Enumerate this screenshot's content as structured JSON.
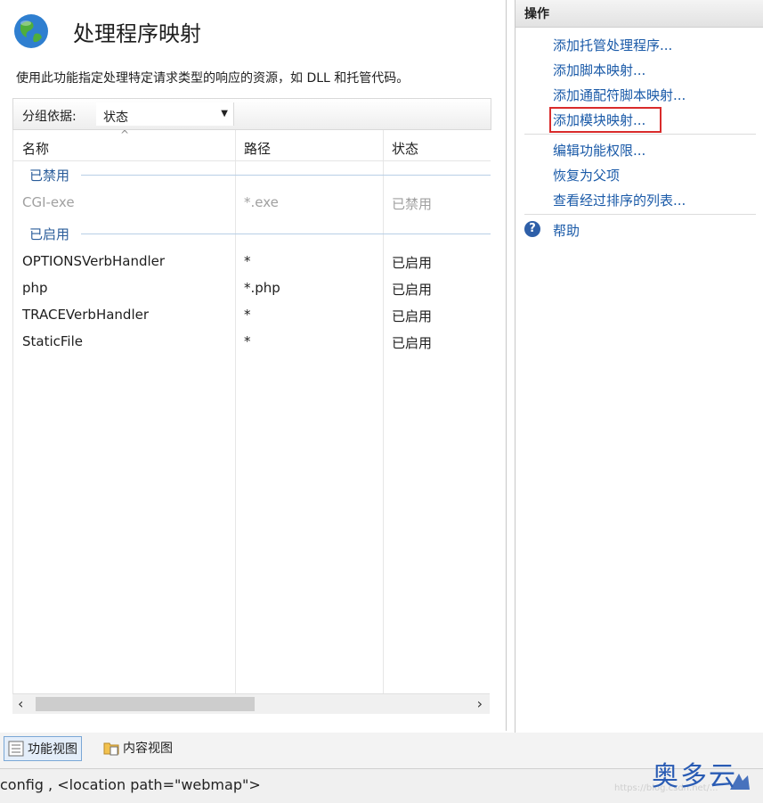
{
  "page": {
    "title": "处理程序映射",
    "description": "使用此功能指定处理特定请求类型的响应的资源，如 DLL 和托管代码。"
  },
  "groupby": {
    "label": "分组依据:",
    "value": "状态"
  },
  "columns": [
    "名称",
    "路径",
    "状态"
  ],
  "groups": [
    {
      "label": "已禁用",
      "rows": [
        {
          "name": "CGI-exe",
          "path": "*.exe",
          "status": "已禁用"
        }
      ]
    },
    {
      "label": "已启用",
      "rows": [
        {
          "name": "OPTIONSVerbHandler",
          "path": "*",
          "status": "已启用"
        },
        {
          "name": "php",
          "path": "*.php",
          "status": "已启用"
        },
        {
          "name": "TRACEVerbHandler",
          "path": "*",
          "status": "已启用"
        },
        {
          "name": "StaticFile",
          "path": "*",
          "status": "已启用"
        }
      ]
    }
  ],
  "actions": {
    "title": "操作",
    "items": [
      "添加托管处理程序...",
      "添加脚本映射...",
      "添加通配符脚本映射...",
      "添加模块映射...",
      "编辑功能权限...",
      "恢复为父项",
      "查看经过排序的列表...",
      "帮助"
    ]
  },
  "view_tabs": [
    "功能视图",
    "内容视图"
  ],
  "status_bar": {
    "text": "config , <location path=\"webmap\">"
  },
  "watermark": "https://blog.csdn.net/...",
  "brand": "奥多云",
  "colors": {
    "link": "#1a5aa8",
    "group": "#2a5c9a",
    "highlight": "#d92b2b",
    "disabled": "#a0a0a0"
  },
  "icons": {
    "title": "globe-icon",
    "help": "help-icon",
    "features_tab": "features-view-icon",
    "content_tab": "content-view-icon"
  }
}
